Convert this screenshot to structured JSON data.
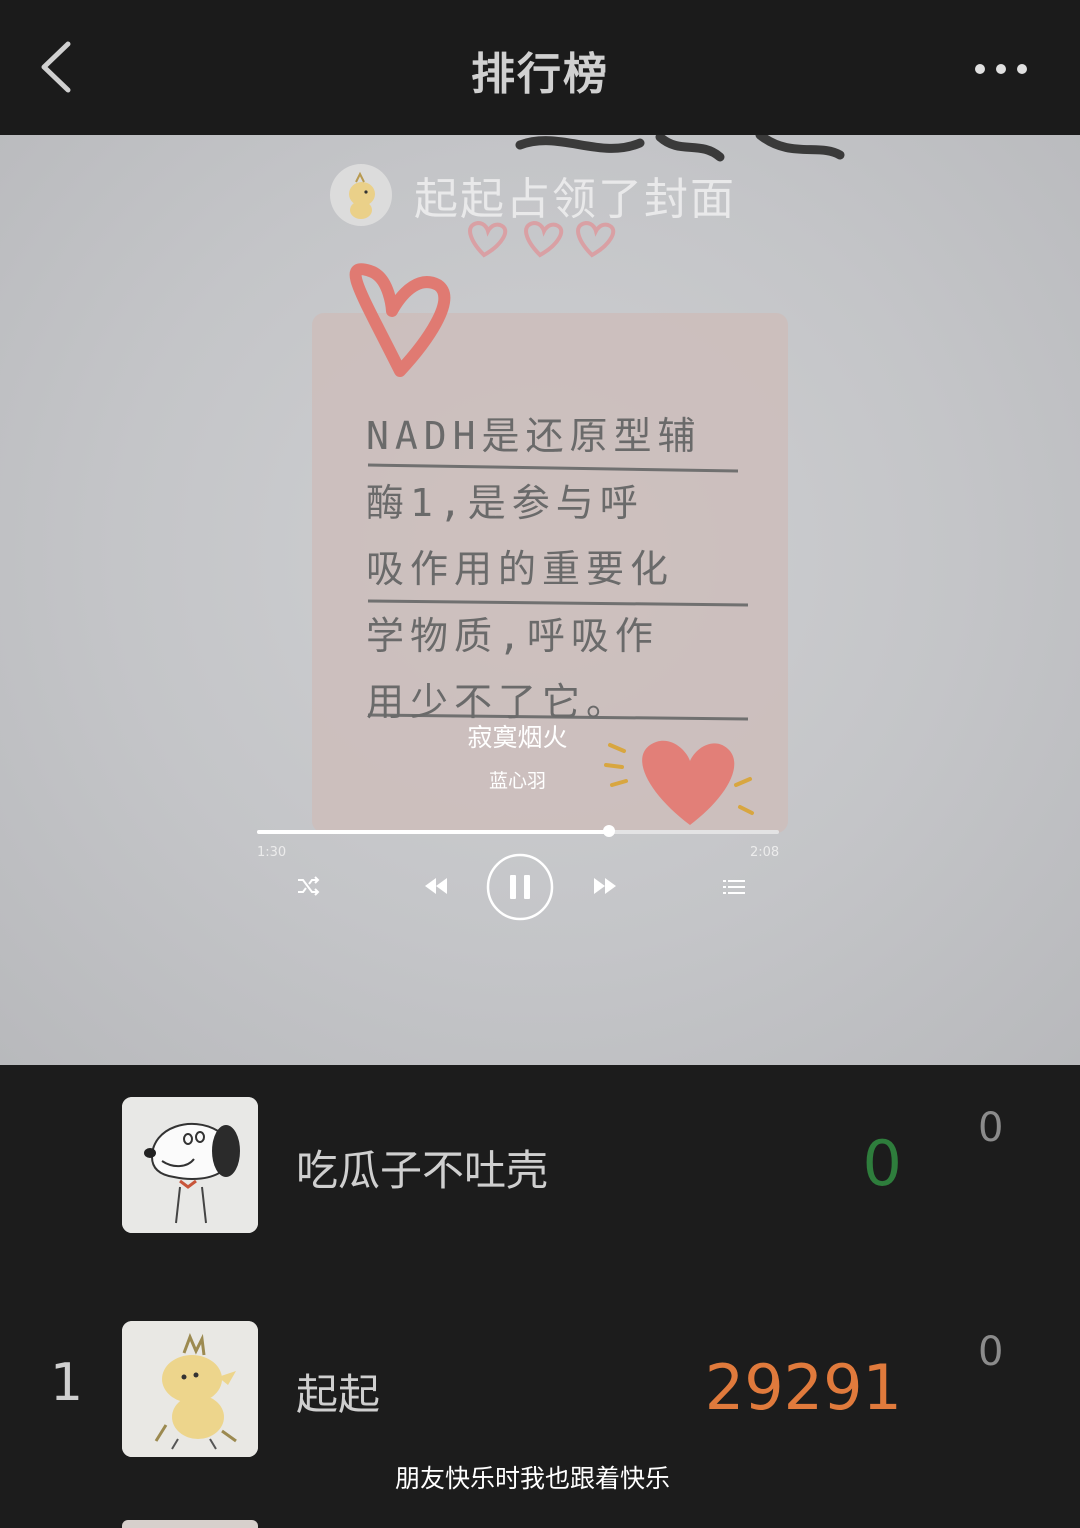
{
  "header": {
    "title": "排行榜",
    "back_icon": "chevron-left-icon",
    "more_icon": "ellipsis-icon"
  },
  "cover": {
    "occupied_text": "起起占领了封面",
    "note_lines": [
      "NADH是还原型辅",
      "酶1,是参与呼",
      "吸作用的重要化",
      "学物质,呼吸作",
      "用少不了它。"
    ]
  },
  "player": {
    "song_title": "寂寞烟火",
    "artist": "蓝心羽",
    "elapsed": "1:30",
    "total": "2:08",
    "progress": 0.675,
    "controls": [
      "shuffle-icon",
      "previous-icon",
      "pause-icon",
      "next-icon",
      "playlist-icon"
    ]
  },
  "leaderboard": {
    "rows": [
      {
        "rank": "",
        "name": "吃瓜子不吐壳",
        "score": "0",
        "likes": "0",
        "score_color": "#2e7d3c"
      },
      {
        "rank": "1",
        "name": "起起",
        "score": "29291",
        "likes": "0",
        "score_color": "#e07a3c"
      }
    ]
  },
  "caption": "朋友快乐时我也跟着快乐"
}
